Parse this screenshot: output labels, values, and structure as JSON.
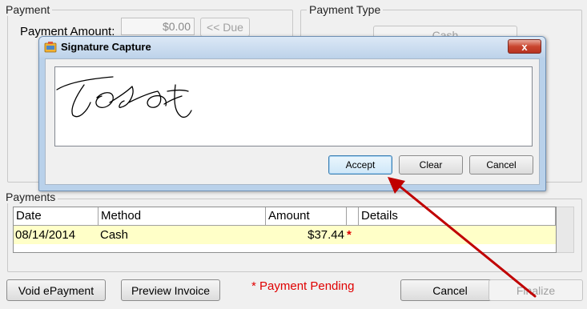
{
  "payment": {
    "title": "Payment",
    "amount_label": "Payment Amount:",
    "amount_value": "$0.00",
    "due_button": "<< Due"
  },
  "payment_type": {
    "title": "Payment Type",
    "cash_button": "Cash"
  },
  "dialog": {
    "title": "Signature Capture",
    "close": "x",
    "accept": "Accept",
    "clear": "Clear",
    "cancel": "Cancel"
  },
  "payments": {
    "title": "Payments",
    "columns": [
      "Date",
      "Method",
      "Amount",
      "",
      "Details"
    ],
    "rows": [
      {
        "date": "08/14/2014",
        "method": "Cash",
        "amount": "$37.44",
        "flag": "*",
        "details": ""
      }
    ]
  },
  "footer": {
    "void_button": "Void ePayment",
    "preview_button": "Preview Invoice",
    "pending_text": "* Payment Pending",
    "cancel_button": "Cancel",
    "finalize_button": "Finalize"
  },
  "colors": {
    "pending": "#e00000",
    "selected_row": "#ffffc8",
    "arrow": "#c00000"
  }
}
